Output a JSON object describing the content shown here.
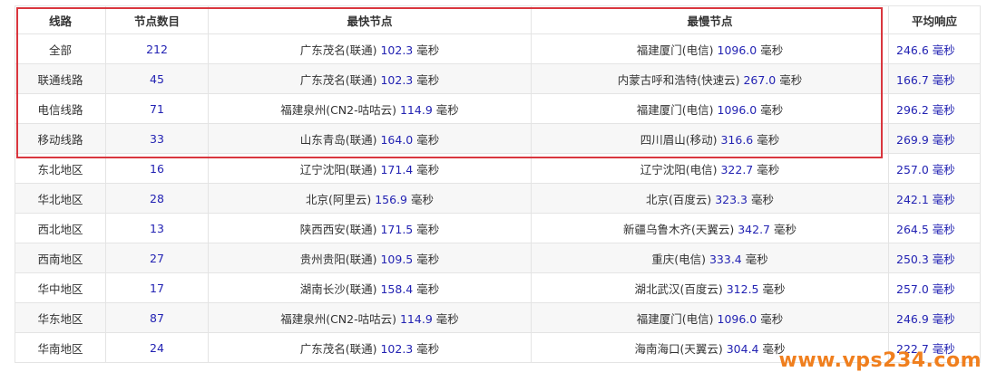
{
  "table": {
    "headers": [
      "线路",
      "节点数目",
      "最快节点",
      "最慢节点",
      "平均响应"
    ],
    "rows": [
      {
        "route": "全部",
        "count": "212",
        "fast_node": "广东茂名(联通)",
        "fast_ms": "102.3",
        "slow_node": "福建厦门(电信)",
        "slow_ms": "1096.0",
        "avg": "246.6 毫秒"
      },
      {
        "route": "联通线路",
        "count": "45",
        "fast_node": "广东茂名(联通)",
        "fast_ms": "102.3",
        "slow_node": "内蒙古呼和浩特(快速云)",
        "slow_ms": "267.0",
        "avg": "166.7 毫秒"
      },
      {
        "route": "电信线路",
        "count": "71",
        "fast_node": "福建泉州(CN2-咕咕云)",
        "fast_ms": "114.9",
        "slow_node": "福建厦门(电信)",
        "slow_ms": "1096.0",
        "avg": "296.2 毫秒"
      },
      {
        "route": "移动线路",
        "count": "33",
        "fast_node": "山东青岛(联通)",
        "fast_ms": "164.0",
        "slow_node": "四川眉山(移动)",
        "slow_ms": "316.6",
        "avg": "269.9 毫秒"
      },
      {
        "route": "东北地区",
        "count": "16",
        "fast_node": "辽宁沈阳(联通)",
        "fast_ms": "171.4",
        "slow_node": "辽宁沈阳(电信)",
        "slow_ms": "322.7",
        "avg": "257.0 毫秒"
      },
      {
        "route": "华北地区",
        "count": "28",
        "fast_node": "北京(阿里云)",
        "fast_ms": "156.9",
        "slow_node": "北京(百度云)",
        "slow_ms": "323.3",
        "avg": "242.1 毫秒"
      },
      {
        "route": "西北地区",
        "count": "13",
        "fast_node": "陕西西安(联通)",
        "fast_ms": "171.5",
        "slow_node": "新疆乌鲁木齐(天翼云)",
        "slow_ms": "342.7",
        "avg": "264.5 毫秒"
      },
      {
        "route": "西南地区",
        "count": "27",
        "fast_node": "贵州贵阳(联通)",
        "fast_ms": "109.5",
        "slow_node": "重庆(电信)",
        "slow_ms": "333.4",
        "avg": "250.3 毫秒"
      },
      {
        "route": "华中地区",
        "count": "17",
        "fast_node": "湖南长沙(联通)",
        "fast_ms": "158.4",
        "slow_node": "湖北武汉(百度云)",
        "slow_ms": "312.5",
        "avg": "257.0 毫秒"
      },
      {
        "route": "华东地区",
        "count": "87",
        "fast_node": "福建泉州(CN2-咕咕云)",
        "fast_ms": "114.9",
        "slow_node": "福建厦门(电信)",
        "slow_ms": "1096.0",
        "avg": "246.9 毫秒"
      },
      {
        "route": "华南地区",
        "count": "24",
        "fast_node": "广东茂名(联通)",
        "fast_ms": "102.3",
        "slow_node": "海南海口(天翼云)",
        "slow_ms": "304.4",
        "avg": "222.7 毫秒"
      }
    ],
    "unit": "毫秒"
  },
  "watermark": "www.vps234.com",
  "colors": {
    "highlight_border": "#d9363e",
    "value_blue": "#2323b3",
    "watermark_orange": "#f07f1e"
  }
}
